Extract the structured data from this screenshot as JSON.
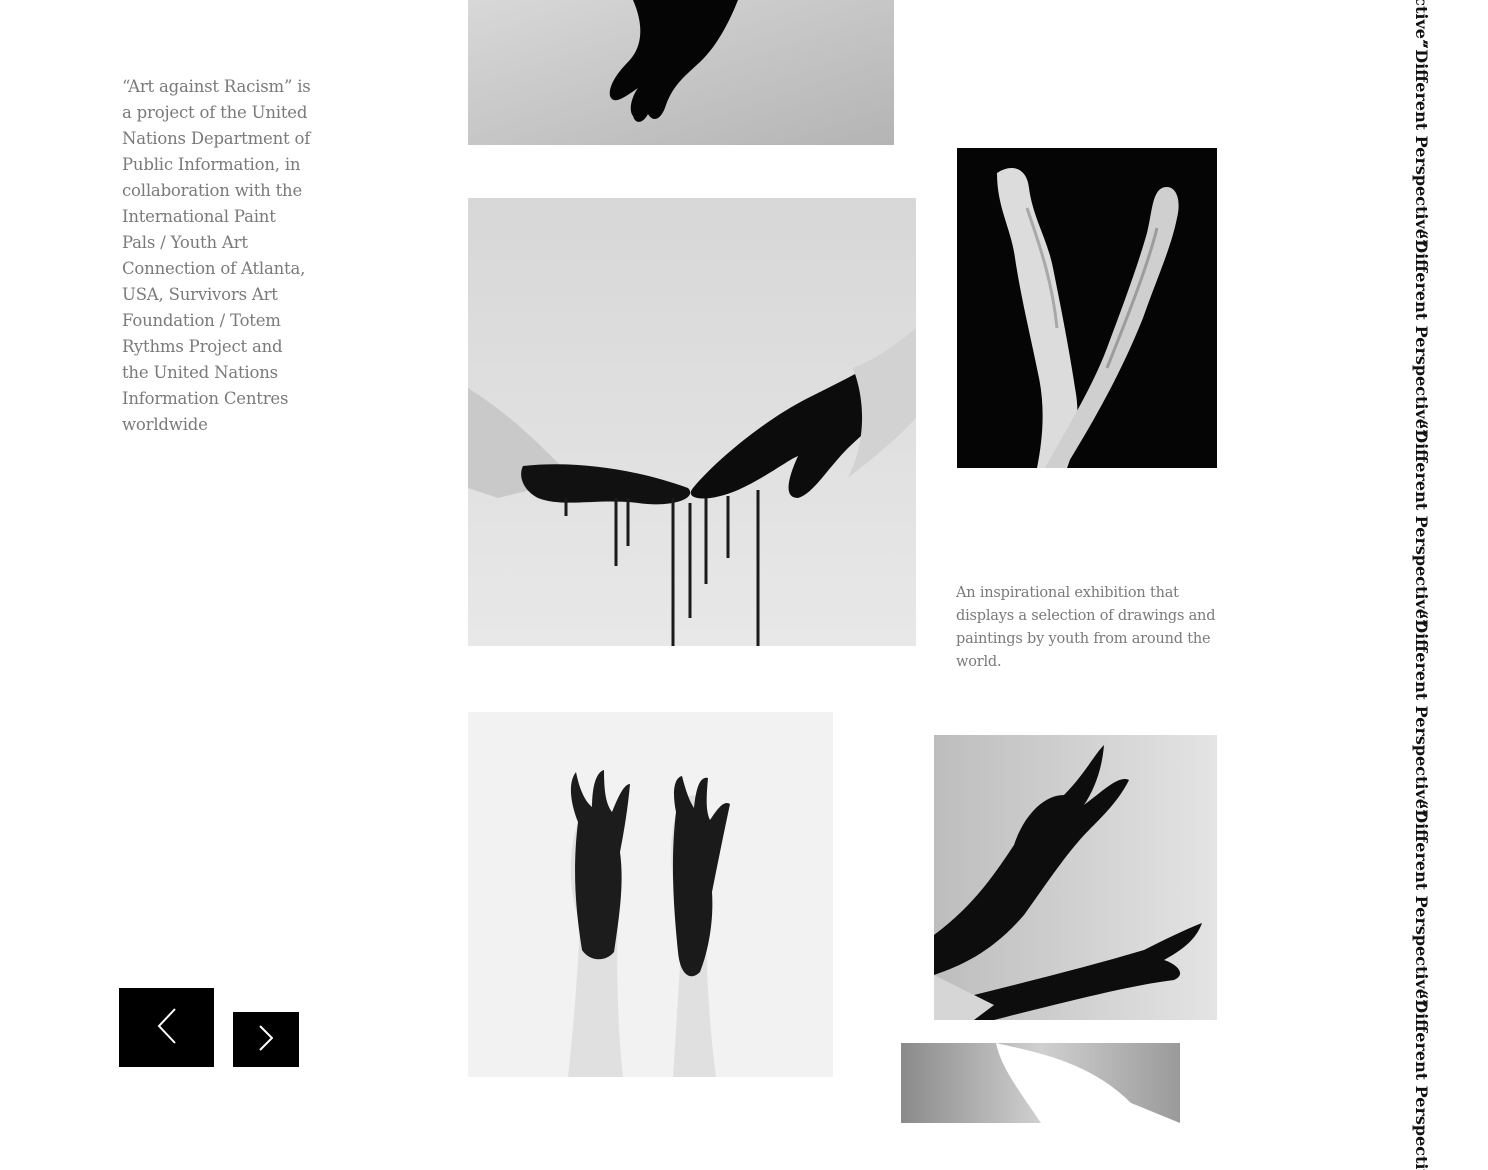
{
  "intro": {
    "text": "“Art against Racism” is a project of the United Nations Department of Public Information, in collaboration with the International Paint Pals / Youth Art Connection of Atlanta, USA, Survivors Art Foundation / Totem Rythms Project and the United Nations Information Centres worldwide"
  },
  "caption": {
    "text": "An inspirational exhibition that displays a selection of drawings and paintings by youth from around the world."
  },
  "navigation": {
    "prev_icon": "chevron-left-icon",
    "next_icon": "chevron-right-icon"
  },
  "vertical_labels": [
    "“Different Perspective”",
    "“Different Perspective”",
    "“Different Perspective”",
    "“Different Perspective”",
    "“Different Perspective”",
    "“Different Perspective”",
    "“Different Perspective”"
  ],
  "colors": {
    "background": "#ffffff",
    "text_muted": "#7a7a7a",
    "button": "#000000",
    "label": "#111111"
  }
}
